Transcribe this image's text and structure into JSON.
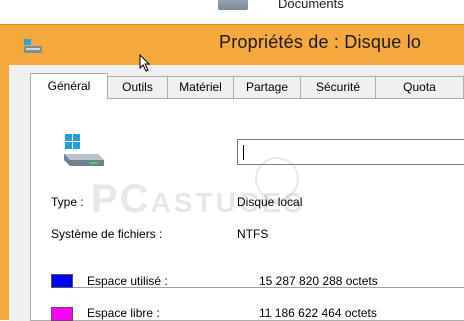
{
  "window": {
    "title": "Propriétés de : Disque lo",
    "behind_text": "Documents"
  },
  "tabs": [
    {
      "label": "Général",
      "active": true
    },
    {
      "label": "Outils",
      "active": false
    },
    {
      "label": "Matériel",
      "active": false
    },
    {
      "label": "Partage",
      "active": false
    },
    {
      "label": "Sécurité",
      "active": false
    },
    {
      "label": "Quota",
      "active": false
    }
  ],
  "general": {
    "name_value": "",
    "type_label": "Type :",
    "type_value": "Disque local",
    "fs_label": "Système de fichiers :",
    "fs_value": "NTFS",
    "used_label": "Espace utilisé :",
    "used_value": "15 287 820 288 octets",
    "used_color": "#0000ff",
    "free_label": "Espace libre :",
    "free_value": "11 186 622 464 octets",
    "free_color": "#ff00ff"
  },
  "watermark": {
    "big": "PC",
    "small": "ASTUCES"
  },
  "icons": {
    "app": "drive-app-icon",
    "drive": "hard-drive-icon",
    "cursor": "mouse-pointer-icon"
  }
}
